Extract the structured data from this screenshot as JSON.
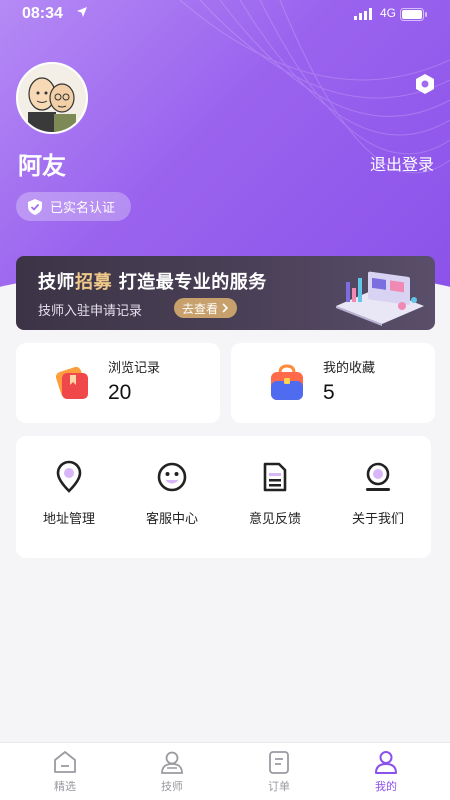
{
  "status_bar": {
    "time": "08:34",
    "network": "4G"
  },
  "profile": {
    "username": "阿友",
    "logout_label": "退出登录",
    "verified_label": "已实名认证"
  },
  "banner": {
    "title_prefix": "技师",
    "title_highlight": "招募",
    "title_suffix": "打造最专业的服务",
    "subtitle": "技师入驻申请记录",
    "button_label": "去查看"
  },
  "stats": [
    {
      "label": "浏览记录",
      "value": "20"
    },
    {
      "label": "我的收藏",
      "value": "5"
    }
  ],
  "menu": [
    {
      "label": "地址管理",
      "icon": "location-pin-icon"
    },
    {
      "label": "客服中心",
      "icon": "smiley-face-icon"
    },
    {
      "label": "意见反馈",
      "icon": "document-icon"
    },
    {
      "label": "关于我们",
      "icon": "person-circle-icon"
    }
  ],
  "tabbar": [
    {
      "label": "精选",
      "icon": "home-icon",
      "active": false
    },
    {
      "label": "技师",
      "icon": "technician-icon",
      "active": false
    },
    {
      "label": "订单",
      "icon": "order-icon",
      "active": false
    },
    {
      "label": "我的",
      "icon": "user-icon",
      "active": true
    }
  ],
  "colors": {
    "accent": "#8b52ea",
    "hero_start": "#b58af5",
    "banner_bg": "#3c3446",
    "banner_highlight": "#f0c989",
    "banner_button": "#c7a06b",
    "icon_accent": "#d7b7f7"
  }
}
